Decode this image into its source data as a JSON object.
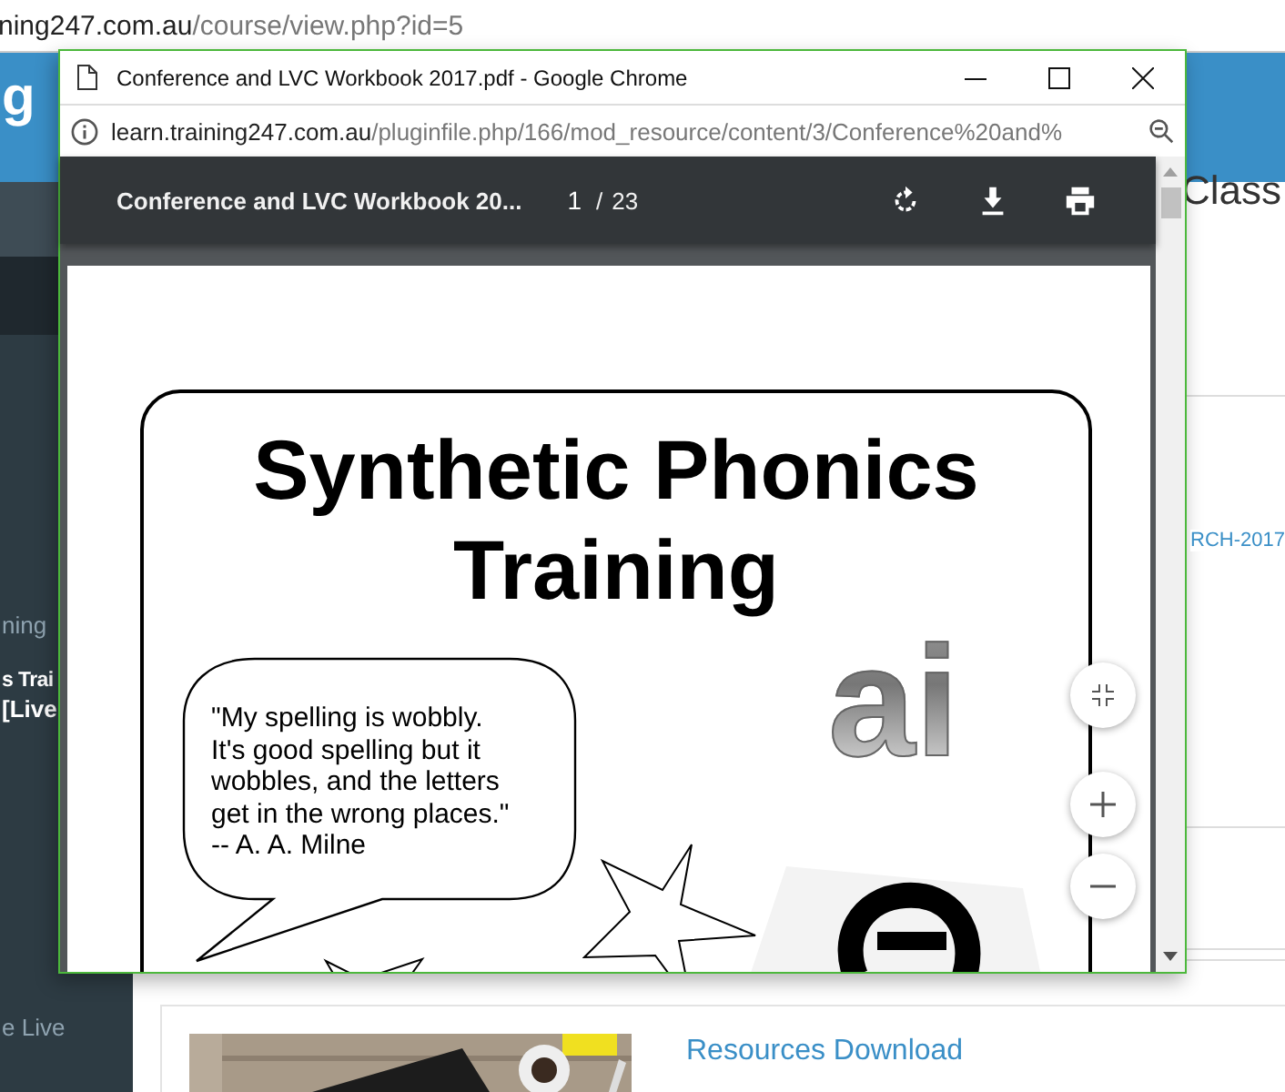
{
  "browser": {
    "url_host": "ning247.com.au",
    "url_path": "/course/view.php?id=5"
  },
  "site": {
    "logo": "g",
    "sidebar_items": [
      {
        "label": "ning",
        "bold": false
      },
      {
        "label": "s Trai",
        "bold": true
      },
      {
        "label": "[Live",
        "bold": true
      },
      {
        "label": "e Live",
        "bold": false
      }
    ],
    "heading": "Class",
    "link": "RCH-2017",
    "card_title": "Resources Download"
  },
  "popup": {
    "title": "Conference and LVC Workbook 2017.pdf - Google Chrome",
    "url_host": "learn.training247.com.au",
    "url_path": "/pluginfile.php/166/mod_resource/content/3/Conference%20and%",
    "pdf": {
      "title": "Conference and LVC Workbook 20...",
      "page": "1",
      "page_separator": "/",
      "page_count": "23",
      "slide": {
        "title_lines": [
          "Synthetic Phonics",
          "Training"
        ],
        "quote_lines": [
          "\"My spelling is wobbly.",
          "It's good spelling but it",
          "wobbles, and the letters",
          "get in the wrong places.\"",
          "-- A. A. Milne"
        ],
        "graphemes": [
          "ai"
        ]
      }
    }
  }
}
